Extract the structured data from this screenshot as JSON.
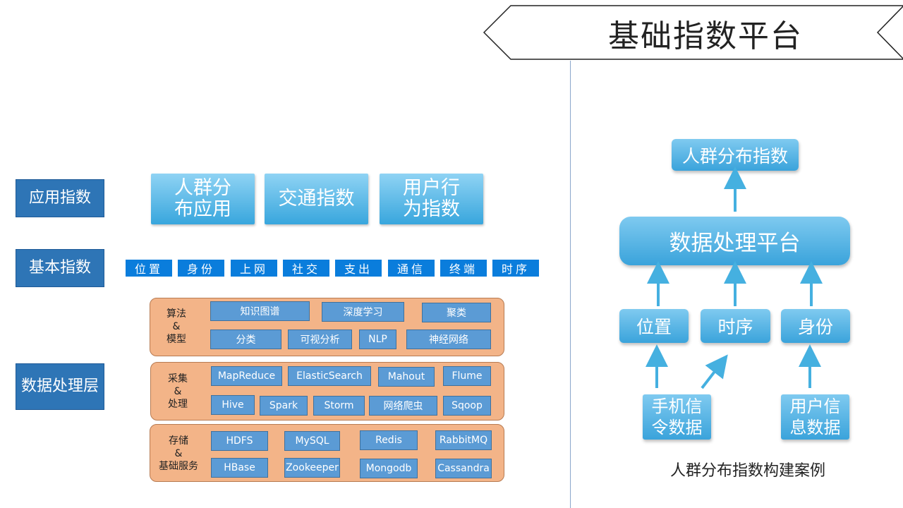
{
  "title": "基础指数平台",
  "rows": {
    "app_index": "应用指数",
    "basic_index": "基本指数",
    "data_layer": "数据处理层"
  },
  "app_tiles": [
    "人群分\n布应用",
    "交通指数",
    "用户行\n为指数"
  ],
  "basic_items": [
    "位置",
    "身份",
    "上网",
    "社交",
    "支出",
    "通信",
    "终端",
    "时序"
  ],
  "layers": {
    "algo": {
      "label": "算法\n&\n模型",
      "items": [
        "知识图谱",
        "深度学习",
        "聚类",
        "分类",
        "可视分析",
        "NLP",
        "神经网络"
      ]
    },
    "collect": {
      "label": "采集\n&\n处理",
      "items": [
        "MapReduce",
        "ElasticSearch",
        "Mahout",
        "Flume",
        "Hive",
        "Spark",
        "Storm",
        "网络爬虫",
        "Sqoop"
      ]
    },
    "storage": {
      "label": "存储\n&\n基础服务",
      "items": [
        "HDFS",
        "MySQL",
        "Redis",
        "RabbitMQ",
        "HBase",
        "Zookeeper",
        "Mongodb",
        "Cassandra"
      ]
    }
  },
  "flow": {
    "top": "人群分布指数",
    "platform": "数据处理平台",
    "mid": [
      "位置",
      "时序",
      "身份"
    ],
    "sources": [
      "手机信\n令数据",
      "用户信\n息数据"
    ]
  },
  "caption": "人群分布指数构建案例",
  "colors": {
    "row_label": "#2e75b6",
    "tile_top": "#8fd3f4",
    "tile_bottom": "#38a6dd",
    "basic_item": "#0a7ddc",
    "layer_fill": "#f3b488",
    "tech_box": "#5b9bd5",
    "arrow": "#45b0e0"
  }
}
